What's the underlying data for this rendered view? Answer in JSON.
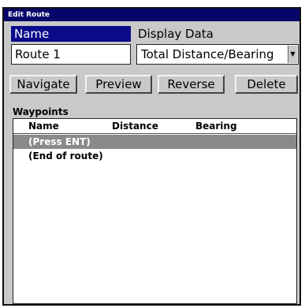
{
  "window": {
    "title": "Edit Route"
  },
  "name_field": {
    "label": "Name",
    "value": "Route 1"
  },
  "display_data": {
    "label": "Display Data",
    "selected": "Total Distance/Bearing"
  },
  "buttons": {
    "navigate": "Navigate",
    "preview": "Preview",
    "reverse": "Reverse",
    "delete": "Delete"
  },
  "waypoints": {
    "label": "Waypoints",
    "columns": [
      "Name",
      "Distance",
      "Bearing"
    ],
    "rows": [
      {
        "name": "(Press ENT)"
      },
      {
        "name": "(End of route)"
      }
    ]
  }
}
